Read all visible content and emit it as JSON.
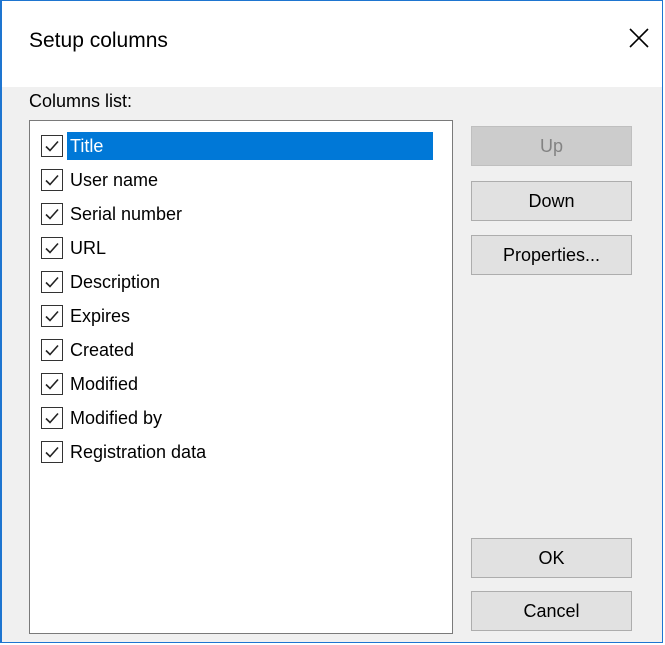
{
  "dialog": {
    "title": "Setup columns",
    "close_icon": "close-icon",
    "accent_color": "#0078d7"
  },
  "columns_label": "Columns list:",
  "columns": [
    {
      "label": "Title",
      "checked": true,
      "selected": true
    },
    {
      "label": "User name",
      "checked": true,
      "selected": false
    },
    {
      "label": "Serial number",
      "checked": true,
      "selected": false
    },
    {
      "label": "URL",
      "checked": true,
      "selected": false
    },
    {
      "label": "Description",
      "checked": true,
      "selected": false
    },
    {
      "label": "Expires",
      "checked": true,
      "selected": false
    },
    {
      "label": "Created",
      "checked": true,
      "selected": false
    },
    {
      "label": "Modified",
      "checked": true,
      "selected": false
    },
    {
      "label": "Modified by",
      "checked": true,
      "selected": false
    },
    {
      "label": "Registration data",
      "checked": true,
      "selected": false
    }
  ],
  "buttons": {
    "up": "Up",
    "up_enabled": false,
    "down": "Down",
    "properties": "Properties...",
    "ok": "OK",
    "cancel": "Cancel"
  }
}
